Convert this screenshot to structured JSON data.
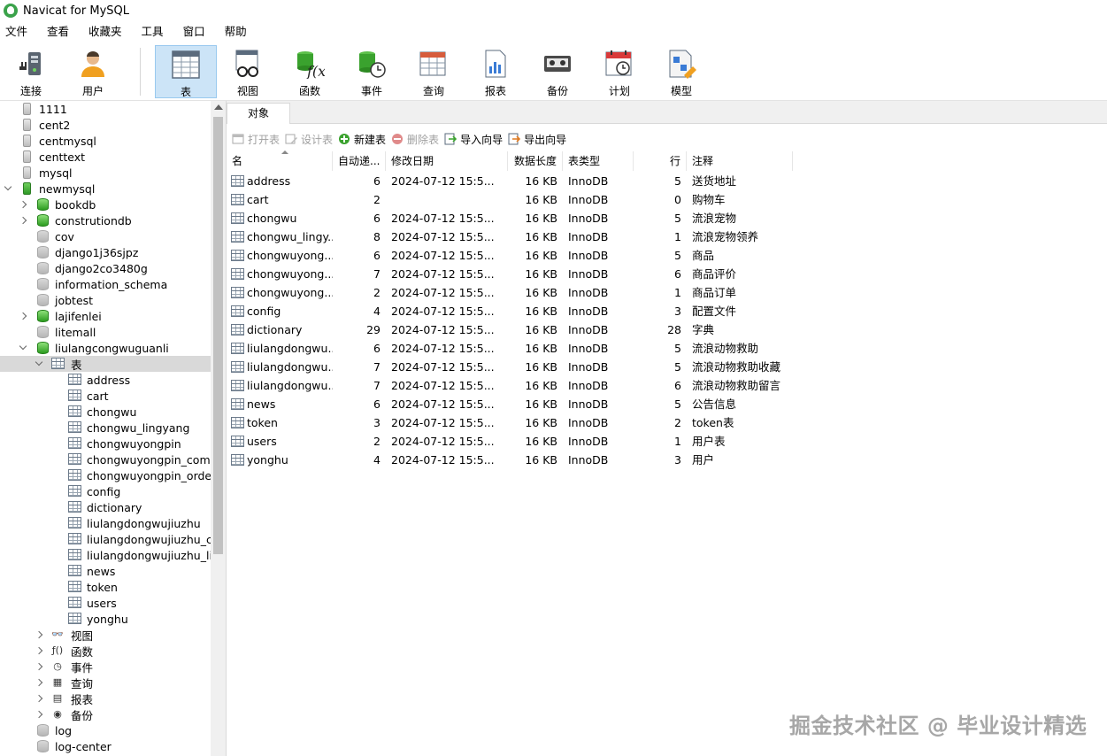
{
  "window": {
    "title": "Navicat for MySQL"
  },
  "menu": [
    "文件",
    "查看",
    "收藏夹",
    "工具",
    "窗口",
    "帮助"
  ],
  "toolbar": {
    "buttons": [
      {
        "label": "连接",
        "icon": "plug-icon"
      },
      {
        "label": "用户",
        "icon": "user-icon"
      },
      {
        "label": "表",
        "icon": "table-icon",
        "active": true
      },
      {
        "label": "视图",
        "icon": "view-glasses-icon"
      },
      {
        "label": "函数",
        "icon": "function-icon"
      },
      {
        "label": "事件",
        "icon": "event-clock-icon"
      },
      {
        "label": "查询",
        "icon": "query-icon"
      },
      {
        "label": "报表",
        "icon": "report-icon"
      },
      {
        "label": "备份",
        "icon": "backup-tape-icon"
      },
      {
        "label": "计划",
        "icon": "schedule-calendar-icon"
      },
      {
        "label": "模型",
        "icon": "model-icon"
      }
    ]
  },
  "sidebar": {
    "connections_top": [
      "1111",
      "cent2",
      "centmysql",
      "centtext",
      "mysql"
    ],
    "open_connection": "newmysql",
    "databases_before": [
      {
        "name": "bookdb",
        "open": true,
        "expandable": true
      },
      {
        "name": "construtiondb",
        "open": true,
        "expandable": true
      },
      {
        "name": "cov",
        "open": false,
        "expandable": false
      },
      {
        "name": "django1j36sjpz",
        "open": false,
        "expandable": false
      },
      {
        "name": "django2co3480g",
        "open": false,
        "expandable": false
      },
      {
        "name": "information_schema",
        "open": false,
        "expandable": false
      },
      {
        "name": "jobtest",
        "open": false,
        "expandable": false
      },
      {
        "name": "lajifenlei",
        "open": true,
        "expandable": true
      },
      {
        "name": "litemall",
        "open": false,
        "expandable": false
      }
    ],
    "active_database": "liulangcongwuguanli",
    "tables_group": "表",
    "tables": [
      "address",
      "cart",
      "chongwu",
      "chongwu_lingyang",
      "chongwuyongpin",
      "chongwuyongpin_comm",
      "chongwuyongpin_order",
      "config",
      "dictionary",
      "liulangdongwujiuzhu",
      "liulangdongwujiuzhu_col",
      "liulangdongwujiuzhu_liuy",
      "news",
      "token",
      "users",
      "yonghu"
    ],
    "other_groups": [
      {
        "label": "视图",
        "icon": "view-glasses-icon",
        "glyph": "👓"
      },
      {
        "label": "函数",
        "icon": "function-icon",
        "glyph": "ƒ()"
      },
      {
        "label": "事件",
        "icon": "event-clock-icon",
        "glyph": "◷"
      },
      {
        "label": "查询",
        "icon": "query-icon",
        "glyph": "▦"
      },
      {
        "label": "报表",
        "icon": "report-icon",
        "glyph": "▤"
      },
      {
        "label": "备份",
        "icon": "backup-tape-icon",
        "glyph": "◉"
      }
    ],
    "databases_after": [
      "log",
      "log-center"
    ]
  },
  "content": {
    "tab": "对象",
    "actions": [
      {
        "label": "打开表",
        "enabled": false,
        "icon": "open-table-icon"
      },
      {
        "label": "设计表",
        "enabled": false,
        "icon": "design-table-icon"
      },
      {
        "label": "新建表",
        "enabled": true,
        "icon": "new-table-icon"
      },
      {
        "label": "删除表",
        "enabled": false,
        "icon": "delete-table-icon"
      },
      {
        "label": "导入向导",
        "enabled": true,
        "icon": "import-wizard-icon"
      },
      {
        "label": "导出向导",
        "enabled": true,
        "icon": "export-wizard-icon"
      }
    ],
    "columns": [
      "名",
      "自动递...",
      "修改日期",
      "数据长度",
      "表类型",
      "行",
      "注释"
    ],
    "rows": [
      [
        "address",
        "6",
        "2024-07-12 15:5...",
        "16 KB",
        "InnoDB",
        "5",
        "送货地址"
      ],
      [
        "cart",
        "2",
        "",
        "16 KB",
        "InnoDB",
        "0",
        "购物车"
      ],
      [
        "chongwu",
        "6",
        "2024-07-12 15:5...",
        "16 KB",
        "InnoDB",
        "5",
        "流浪宠物"
      ],
      [
        "chongwu_lingy...",
        "8",
        "2024-07-12 15:5...",
        "16 KB",
        "InnoDB",
        "1",
        "流浪宠物领养"
      ],
      [
        "chongwuyong...",
        "6",
        "2024-07-12 15:5...",
        "16 KB",
        "InnoDB",
        "5",
        "商品"
      ],
      [
        "chongwuyong...",
        "7",
        "2024-07-12 15:5...",
        "16 KB",
        "InnoDB",
        "6",
        "商品评价"
      ],
      [
        "chongwuyong...",
        "2",
        "2024-07-12 15:5...",
        "16 KB",
        "InnoDB",
        "1",
        "商品订单"
      ],
      [
        "config",
        "4",
        "2024-07-12 15:5...",
        "16 KB",
        "InnoDB",
        "3",
        "配置文件"
      ],
      [
        "dictionary",
        "29",
        "2024-07-12 15:5...",
        "16 KB",
        "InnoDB",
        "28",
        "字典"
      ],
      [
        "liulangdongwu...",
        "6",
        "2024-07-12 15:5...",
        "16 KB",
        "InnoDB",
        "5",
        "流浪动物救助"
      ],
      [
        "liulangdongwu...",
        "7",
        "2024-07-12 15:5...",
        "16 KB",
        "InnoDB",
        "5",
        "流浪动物救助收藏"
      ],
      [
        "liulangdongwu...",
        "7",
        "2024-07-12 15:5...",
        "16 KB",
        "InnoDB",
        "6",
        "流浪动物救助留言"
      ],
      [
        "news",
        "6",
        "2024-07-12 15:5...",
        "16 KB",
        "InnoDB",
        "5",
        "公告信息"
      ],
      [
        "token",
        "3",
        "2024-07-12 15:5...",
        "16 KB",
        "InnoDB",
        "2",
        "token表"
      ],
      [
        "users",
        "2",
        "2024-07-12 15:5...",
        "16 KB",
        "InnoDB",
        "1",
        "用户表"
      ],
      [
        "yonghu",
        "4",
        "2024-07-12 15:5...",
        "16 KB",
        "InnoDB",
        "3",
        "用户"
      ]
    ]
  },
  "watermark": "掘金技术社区 @ 毕业设计精选",
  "colors": {
    "active_button_bg": "#cce4f7",
    "selected_row_bg": "#d9d9d9",
    "db_open_green": "#2c9c1f"
  }
}
